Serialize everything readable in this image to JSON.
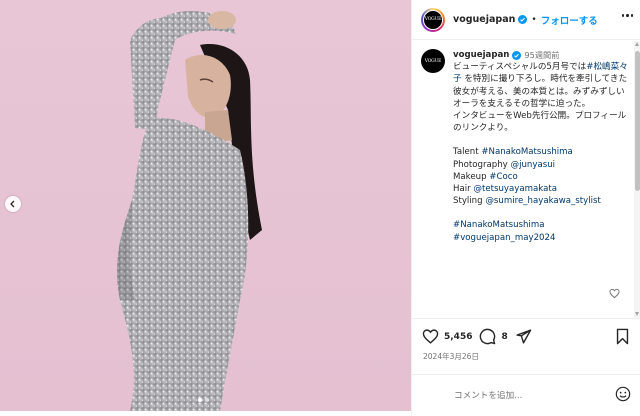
{
  "post": {
    "author": "voguejapan",
    "avatar_text": "VOGUE",
    "follow_label": "フォローする",
    "separator": "•",
    "time_ago": "95週間前",
    "caption_main": "ビューティスペシャルの5月号では",
    "caption_name_tag": "#松嶋菜々子",
    "caption_rest": " を特別に撮り下ろし。時代を牽引してきた彼女が考える、美の本質とは。みずみずしいオーラを支えるその哲学に迫った。\nインタビューをWeb先行公開。プロフィールのリンクより。",
    "credits": [
      {
        "label": "Talent ",
        "value": "#NanakoMatsushima"
      },
      {
        "label": "Photography ",
        "value": "@junyasui"
      },
      {
        "label": "Makeup ",
        "value": "#Coco"
      },
      {
        "label": "Hair ",
        "value": "@tetsuyayamakata"
      },
      {
        "label": "Styling ",
        "value": "@sumire_hayakawa_stylist"
      }
    ],
    "hashtags": [
      "#NanakoMatsushima",
      "#voguejapan_may2024"
    ],
    "likes": "5,456",
    "comments": "8",
    "date": "2024年3月26日",
    "comment_placeholder": "コメントを追加..."
  },
  "icons": {
    "verified": "verified-badge-icon",
    "more": "more-options-icon",
    "like": "heart-icon",
    "comment": "comment-icon",
    "share": "paper-plane-icon",
    "save": "bookmark-icon",
    "emoji": "smiley-icon",
    "prev": "chevron-left-icon"
  },
  "colors": {
    "accent": "#0095f6",
    "link": "#00376b",
    "muted": "#737373",
    "background_image": "#e6c3d3"
  },
  "carousel": {
    "slide_count": 2,
    "active_slide": 1
  }
}
